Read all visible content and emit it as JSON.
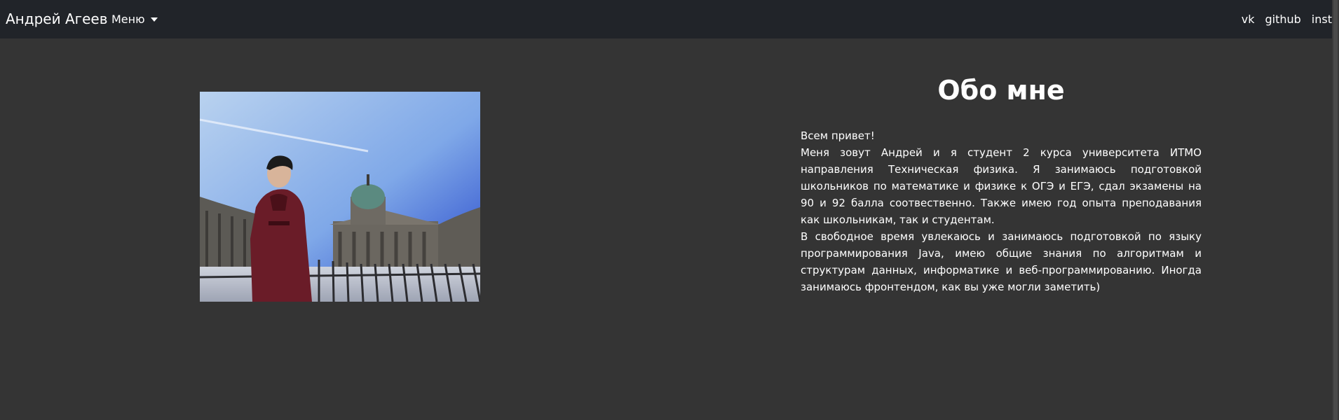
{
  "navbar": {
    "brand": "Андрей Агеев",
    "menu_label": "Меню",
    "links": [
      "vk",
      "github",
      "inst"
    ]
  },
  "about": {
    "title": "Обо мне",
    "paragraphs": [
      "Всем привет!",
      "Меня зовут Андрей и я студент 2 курса университета ИТМО направления Техническая физика. Я занимаюсь подготовкой школьников по математике и физике к ОГЭ и ЕГЭ, сдал экзамены на 90 и 92 балла соотвественно. Также имею год опыта преподавания как школьникам, так и студентам.",
      "В свободное время увлекаюсь и занимаюсь подготовкой по языку программирования Java, имею общие знания по алгоритмам и структурам данных, информатике и веб-программированию. Иногда занимаюсь фронтендом, как вы уже могли заметить)"
    ]
  },
  "colors": {
    "navbar_bg": "#212429",
    "page_bg": "#343434",
    "text": "#ffffff"
  }
}
